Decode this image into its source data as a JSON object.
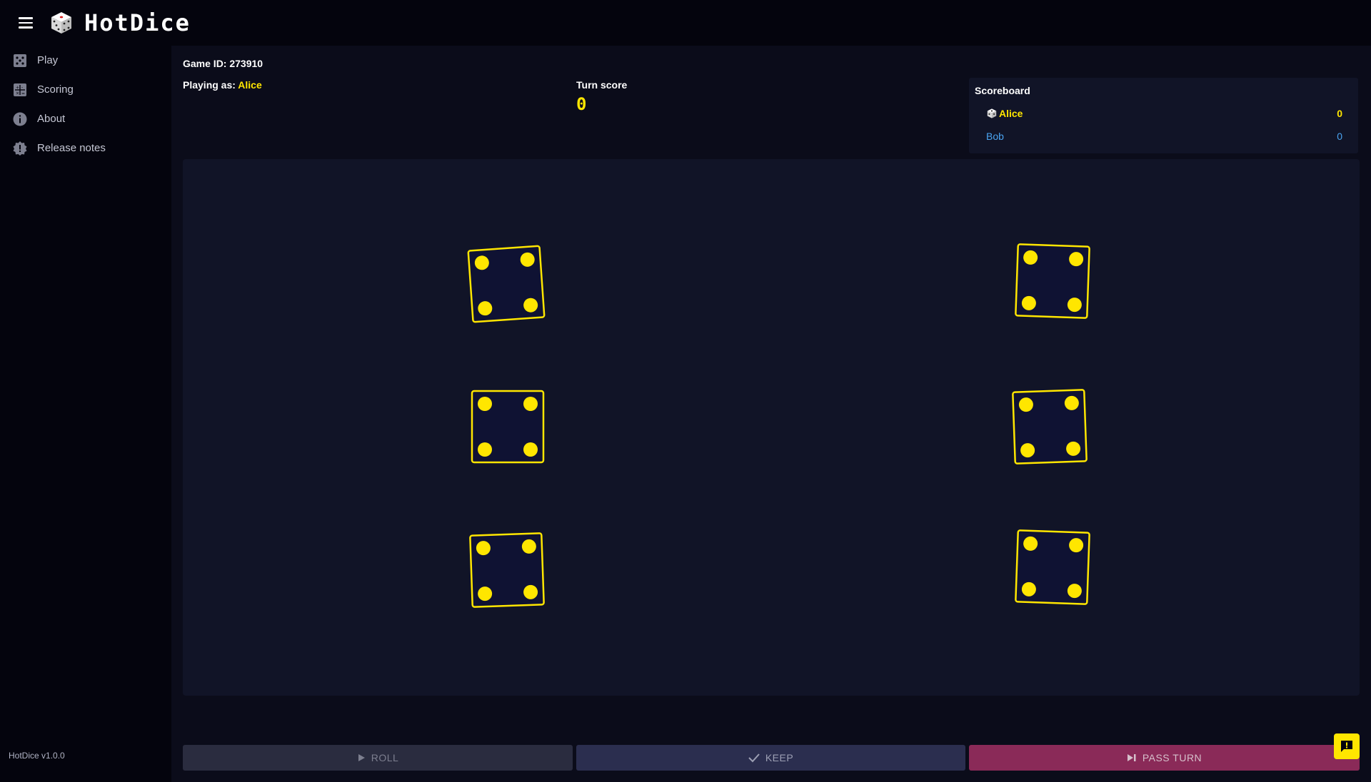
{
  "app": {
    "title": "HotDice",
    "version": "HotDice v1.0.0"
  },
  "sidebar": {
    "items": [
      {
        "label": "Play",
        "icon": "dice-icon"
      },
      {
        "label": "Scoring",
        "icon": "scoring-icon"
      },
      {
        "label": "About",
        "icon": "info-icon"
      },
      {
        "label": "Release notes",
        "icon": "badge-icon"
      }
    ]
  },
  "game": {
    "id_label": "Game ID: 273910",
    "playing_as_label": "Playing as:",
    "player_name": "Alice",
    "turn_score_label": "Turn score",
    "turn_score": "0"
  },
  "scoreboard": {
    "title": "Scoreboard",
    "players": [
      {
        "name": "Alice",
        "score": "0",
        "current": true
      },
      {
        "name": "Bob",
        "score": "0",
        "current": false
      }
    ]
  },
  "dice": [
    {
      "value": 4
    },
    {
      "value": 4
    },
    {
      "value": 4
    },
    {
      "value": 4
    },
    {
      "value": 4
    },
    {
      "value": 4
    }
  ],
  "actions": {
    "roll": "Roll",
    "keep": "Keep",
    "pass": "Pass turn"
  },
  "colors": {
    "accent": "#ffe600",
    "player2": "#4aa3f0",
    "pass": "#8a2a58",
    "background": "#0b0c1a",
    "panel": "#111427"
  }
}
